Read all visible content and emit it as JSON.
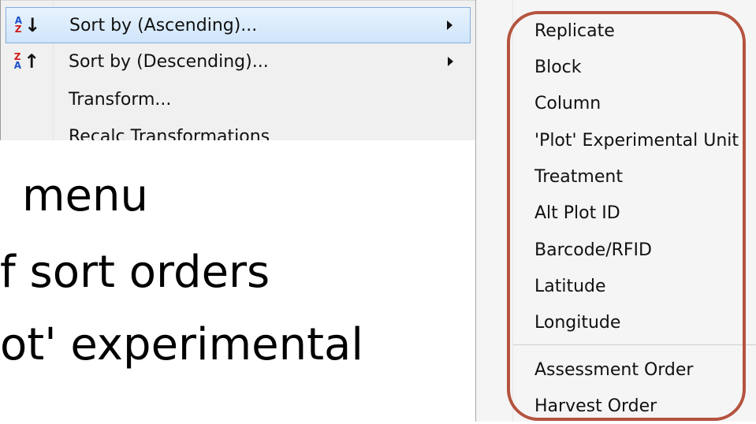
{
  "context_menu": {
    "items": [
      {
        "label": "Sort by (Ascending)...",
        "icon": "sort-ascending-icon",
        "has_submenu": true,
        "highlighted": true
      },
      {
        "label": "Sort by (Descending)...",
        "icon": "sort-descending-icon",
        "has_submenu": true,
        "highlighted": false
      },
      {
        "label": "Transform...",
        "icon": "",
        "has_submenu": false,
        "highlighted": false
      },
      {
        "label": "Recalc Transformations",
        "icon": "",
        "has_submenu": false,
        "highlighted": false
      }
    ]
  },
  "slide_text": {
    "line1": "menu",
    "line2": "f sort orders",
    "line3": "ot' experimental"
  },
  "submenu": {
    "items": [
      "Replicate",
      "Block",
      "Column",
      "'Plot' Experimental Unit",
      "Treatment",
      "Alt Plot ID",
      "Barcode/RFID",
      "Latitude",
      "Longitude",
      "Assessment Order",
      "Harvest Order"
    ]
  },
  "colors": {
    "highlight_ring": "#b5533f",
    "menu_highlight_border": "#84acdd"
  }
}
